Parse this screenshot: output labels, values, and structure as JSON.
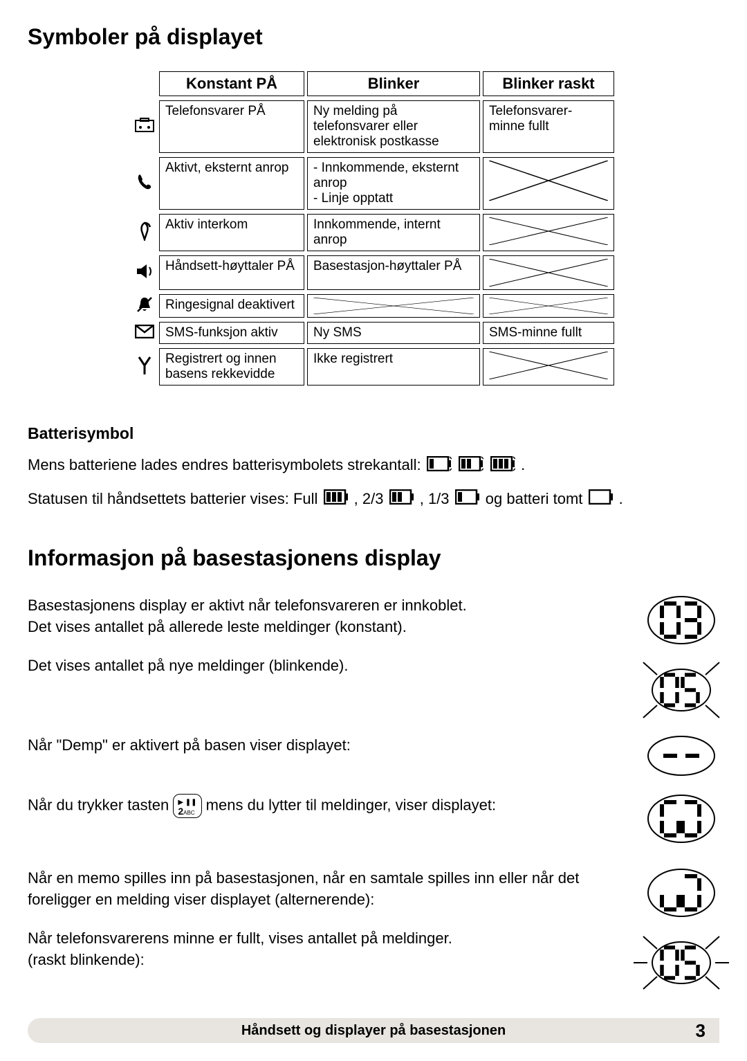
{
  "title_main": "Symboler på displayet",
  "table": {
    "headers": [
      "Konstant PÅ",
      "Blinker",
      "Blinker raskt"
    ],
    "rows": [
      {
        "c1": "Telefonsvarer PÅ",
        "c2": "Ny melding på telefonsvarer eller elektronisk postkasse",
        "c3": "Telefonsvarer-minne fullt"
      },
      {
        "c1": "Aktivt, eksternt anrop",
        "c2": "- Innkommende, eksternt anrop\n- Linje opptatt",
        "c3": "X"
      },
      {
        "c1": "Aktiv interkom",
        "c2": "Innkommende, internt anrop",
        "c3": "X"
      },
      {
        "c1": "Håndsett-høyttaler PÅ",
        "c2": "Basestasjon-høyttaler PÅ",
        "c3": "X"
      },
      {
        "c1": "Ringesignal deaktivert",
        "c2": "X",
        "c3": "X"
      },
      {
        "c1": "SMS-funksjon aktiv",
        "c2": "Ny SMS",
        "c3": "SMS-minne fullt"
      },
      {
        "c1": "Registrert og innen basens rekkevidde",
        "c2": "Ikke registrert",
        "c3": "X"
      }
    ]
  },
  "battery_heading": "Batterisymbol",
  "battery_p1_a": "Mens batteriene lades endres batterisymbolets strekantall: ",
  "battery_p1_b": ".",
  "battery_p2_a": "Statusen til håndsettets batterier vises: Full ",
  "battery_p2_b": ", 2/3 ",
  "battery_p2_c": ", 1/3 ",
  "battery_p2_d": " og batteri tomt ",
  "battery_p2_e": ".",
  "title_info": "Informasjon på basestasjonens display",
  "info": [
    "Basestasjonens display er aktivt når telefonsvareren er innkoblet.\nDet vises antallet på allerede leste meldinger (konstant).",
    "Det vises antallet på nye meldinger (blinkende).",
    "Når \"Demp\" er aktivert på basen viser displayet:",
    "Når du trykker tasten  mens du lytter til meldinger, viser displayet:",
    "Når en memo spilles inn på basestasjonen, når en samtale spilles inn eller når det foreligger en melding viser displayet (alternerende):",
    "Når telefonsvarerens minne er fullt, vises antallet på meldinger.\n(raskt blinkende):"
  ],
  "info3_a": "Når du trykker tasten ",
  "info3_b": " mens du lytter til meldinger, viser displayet:",
  "footer_text": "Håndsett og displayer på basestasjonen",
  "footer_page": "3"
}
